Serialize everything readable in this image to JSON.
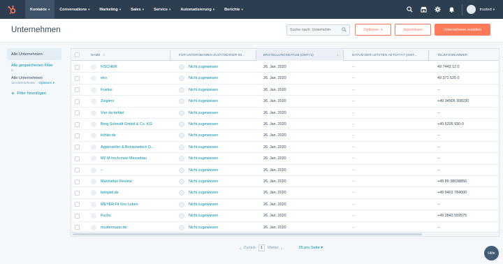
{
  "nav": {
    "items": [
      {
        "label": "Kontakte",
        "active": true
      },
      {
        "label": "Conversations",
        "active": false
      },
      {
        "label": "Marketing",
        "active": false
      },
      {
        "label": "Sales",
        "active": false
      },
      {
        "label": "Service",
        "active": false
      },
      {
        "label": "Automatisierung",
        "active": false
      },
      {
        "label": "Berichte",
        "active": false
      }
    ],
    "icons": [
      "search-icon",
      "marketplace-icon",
      "settings-icon",
      "notifications-icon"
    ],
    "user": "trusted"
  },
  "header": {
    "title": "Unternehmen",
    "search_placeholder": "Suche nach: Unternehm",
    "options_label": "Optionen",
    "import_label": "Importieren",
    "create_label": "Unternehmen erstellen"
  },
  "sidebar": {
    "all_companies": "Alle Unternehmen",
    "saved_filters": "Alle gespeicherten Filter",
    "saved_filters_count": "3",
    "view_title": "Alle Unternehmen",
    "view_count": "18 Unternehmen",
    "view_options": "Optionen",
    "add_filter": "Filter hinzufügen"
  },
  "table": {
    "columns": [
      "Name",
      "Für Unternehmen zuständiger Mi...",
      "Erstellungsdatum (GMT+1)",
      "Datum der letzten Aktivität (GMT...",
      "Telefonnummer"
    ],
    "rows": [
      {
        "name": "FISCHER",
        "owner": "Nicht zugewiesen",
        "created": "26. Jan. 2020",
        "last_activity": "--",
        "phone": "49 7443 12 0"
      },
      {
        "name": "elro",
        "owner": "Nicht zugewiesen",
        "created": "26. Jan. 2020",
        "last_activity": "--",
        "phone": "49 371 525 0"
      },
      {
        "name": "Franke",
        "owner": "Nicht zugewiesen",
        "created": "26. Jan. 2020",
        "last_activity": "--",
        "phone": "--"
      },
      {
        "name": "Zieglers",
        "owner": "Nicht zugewiesen",
        "created": "26. Jan. 2020",
        "last_activity": "--",
        "phone": "+49 34905 308230"
      },
      {
        "name": "Vier da befdel",
        "owner": "Nicht zugewiesen",
        "created": "26. Jan. 2020",
        "last_activity": "--",
        "phone": "--"
      },
      {
        "name": "Berg Schmidt GmbH & Co. KG",
        "owner": "Nicht zugewiesen",
        "created": "26. Jan. 2020",
        "last_activity": "--",
        "phone": "+49 5205 930-0"
      },
      {
        "name": "köhler.de",
        "owner": "Nicht zugewiesen",
        "created": "26. Jan. 2020",
        "last_activity": "--",
        "phone": "--"
      },
      {
        "name": "Appenzeller & Bonisowitsch D...",
        "owner": "Nicht zugewiesen",
        "created": "26. Jan. 2020",
        "last_activity": "--",
        "phone": "--"
      },
      {
        "name": "M2 M-hoch-zwei Messebau",
        "owner": "Nicht zugewiesen",
        "created": "26. Jan. 2020",
        "last_activity": "--",
        "phone": "--"
      },
      {
        "name": "--",
        "owner": "Nicht zugewiesen",
        "created": "26. Jan. 2020",
        "last_activity": "--",
        "phone": "--"
      },
      {
        "name": "Manhattan Review",
        "owner": "Nicht zugewiesen",
        "created": "26. Jan. 2020",
        "last_activity": "--",
        "phone": "+49 89 38038856"
      },
      {
        "name": "beispiel.de",
        "owner": "Nicht zugewiesen",
        "created": "26. Jan. 2020",
        "last_activity": "--",
        "phone": "+49 9401 784000"
      },
      {
        "name": "MEYER Fit fürs Leben",
        "owner": "Nicht zugewiesen",
        "created": "26. Jan. 2020",
        "last_activity": "--",
        "phone": "--"
      },
      {
        "name": "Fuchs",
        "owner": "Nicht zugewiesen",
        "created": "26. Jan. 2020",
        "last_activity": "--",
        "phone": "+49 2842 559575"
      },
      {
        "name": "mustermann.de",
        "owner": "Nicht zugewiesen",
        "created": "26. Jan. 2020",
        "last_activity": "--",
        "phone": "--"
      }
    ]
  },
  "pagination": {
    "prev": "Zurück",
    "page": "1",
    "next": "Weiter",
    "per_page": "25 pro Seite"
  },
  "help": "Hilfe",
  "colors": {
    "nav_bg": "#2d3e50",
    "accent": "#ff7a59",
    "link": "#0091ae"
  }
}
